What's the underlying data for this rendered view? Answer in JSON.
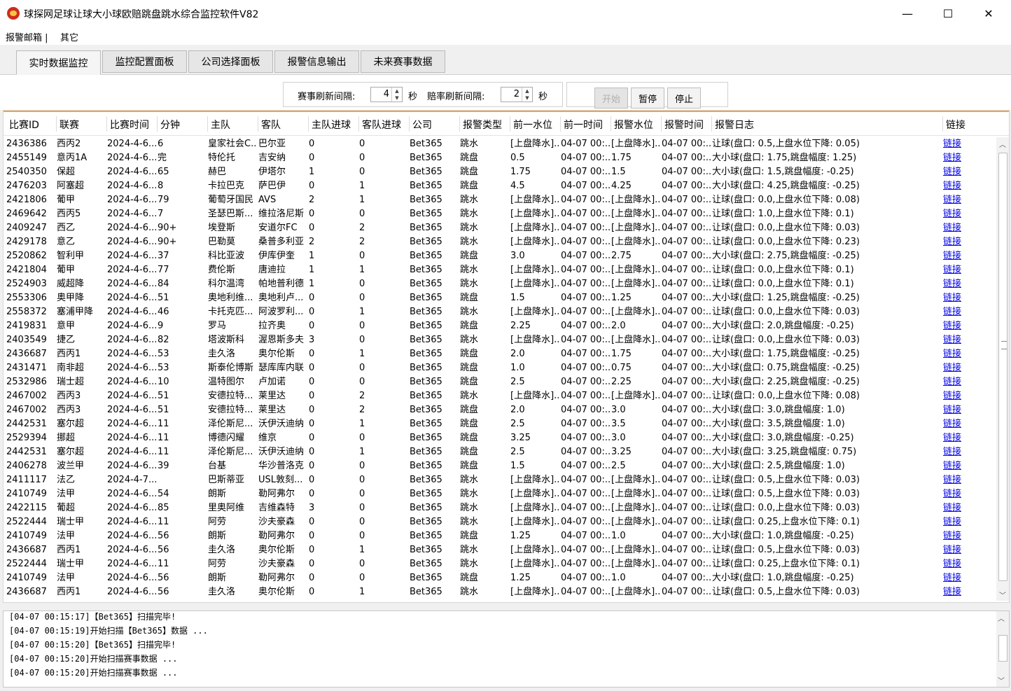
{
  "window": {
    "title": "球探网足球让球大小球欧赔跳盘跳水综合监控软件V82",
    "minimize": "—",
    "maximize": "☐",
    "close": "✕"
  },
  "menu": [
    "报警邮箱 |",
    "其它"
  ],
  "tabs": [
    "实时数据监控",
    "监控配置面板",
    "公司选择面板",
    "报警信息输出",
    "未来赛事数据"
  ],
  "controls": {
    "match_refresh_label": "赛事刷新间隔:",
    "match_refresh_value": "4",
    "odds_refresh_label": "赔率刷新间隔:",
    "odds_refresh_value": "2",
    "unit": "秒",
    "start": "开始",
    "pause": "暂停",
    "stop": "停止"
  },
  "grid": {
    "columns": [
      "比赛ID",
      "联赛",
      "比赛时间",
      "分钟",
      "主队",
      "客队",
      "主队进球",
      "客队进球",
      "公司",
      "报警类型",
      "前一水位",
      "前一时间",
      "报警水位",
      "报警时间",
      "报警日志",
      "链接"
    ],
    "rows": [
      [
        "2436386",
        "西丙2",
        "2024-4-6...",
        "6",
        "皇家社会C...",
        "巴尔亚",
        "0",
        "0",
        "Bet365",
        "跳水",
        "[上盘降水]...",
        "04-07 00:...",
        "[上盘降水]...",
        "04-07 00:...",
        "让球(盘口: 0.5,上盘水位下降: 0.05)",
        "链接"
      ],
      [
        "2455149",
        "意丙1A",
        "2024-4-6...",
        "完",
        "特伦托",
        "吉安纳",
        "0",
        "0",
        "Bet365",
        "跳盘",
        "0.5",
        "04-07 00:...",
        "1.75",
        "04-07 00:...",
        "大小球(盘口: 1.75,跳盘幅度: 1.25)",
        "链接"
      ],
      [
        "2540350",
        "保超",
        "2024-4-6...",
        "65",
        "赫巴",
        "伊塔尔",
        "1",
        "0",
        "Bet365",
        "跳盘",
        "1.75",
        "04-07 00:...",
        "1.5",
        "04-07 00:...",
        "大小球(盘口: 1.5,跳盘幅度: -0.25)",
        "链接"
      ],
      [
        "2476203",
        "阿塞超",
        "2024-4-6...",
        "8",
        "卡拉巴克",
        "萨巴伊",
        "0",
        "1",
        "Bet365",
        "跳盘",
        "4.5",
        "04-07 00:...",
        "4.25",
        "04-07 00:...",
        "大小球(盘口: 4.25,跳盘幅度: -0.25)",
        "链接"
      ],
      [
        "2421806",
        "葡甲",
        "2024-4-6...",
        "79",
        "葡萄牙国民",
        "AVS",
        "2",
        "1",
        "Bet365",
        "跳水",
        "[上盘降水]...",
        "04-07 00:...",
        "[上盘降水]...",
        "04-07 00:...",
        "让球(盘口: 0.0,上盘水位下降: 0.08)",
        "链接"
      ],
      [
        "2469642",
        "西丙5",
        "2024-4-6...",
        "7",
        "圣瑟巴斯...",
        "维拉洛尼斯",
        "0",
        "0",
        "Bet365",
        "跳水",
        "[上盘降水]...",
        "04-07 00:...",
        "[上盘降水]...",
        "04-07 00:...",
        "让球(盘口: 1.0,上盘水位下降: 0.1)",
        "链接"
      ],
      [
        "2409247",
        "西乙",
        "2024-4-6...",
        "90+",
        "埃登斯",
        "安道尔FC",
        "0",
        "2",
        "Bet365",
        "跳水",
        "[上盘降水]...",
        "04-07 00:...",
        "[上盘降水]...",
        "04-07 00:...",
        "让球(盘口: 0.0,上盘水位下降: 0.03)",
        "链接"
      ],
      [
        "2429178",
        "意乙",
        "2024-4-6...",
        "90+",
        "巴勒莫",
        "桑普多利亚",
        "2",
        "2",
        "Bet365",
        "跳水",
        "[上盘降水]...",
        "04-07 00:...",
        "[上盘降水]...",
        "04-07 00:...",
        "让球(盘口: 0.0,上盘水位下降: 0.23)",
        "链接"
      ],
      [
        "2520862",
        "智利甲",
        "2024-4-6...",
        "37",
        "科比亚波",
        "伊库伊奎",
        "1",
        "0",
        "Bet365",
        "跳盘",
        "3.0",
        "04-07 00:...",
        "2.75",
        "04-07 00:...",
        "大小球(盘口: 2.75,跳盘幅度: -0.25)",
        "链接"
      ],
      [
        "2421804",
        "葡甲",
        "2024-4-6...",
        "77",
        "费伦斯",
        "唐迪拉",
        "1",
        "1",
        "Bet365",
        "跳水",
        "[上盘降水]...",
        "04-07 00:...",
        "[上盘降水]...",
        "04-07 00:...",
        "让球(盘口: 0.0,上盘水位下降: 0.1)",
        "链接"
      ],
      [
        "2524903",
        "威超降",
        "2024-4-6...",
        "84",
        "科尔温湾",
        "帕地普利德",
        "1",
        "0",
        "Bet365",
        "跳水",
        "[上盘降水]...",
        "04-07 00:...",
        "[上盘降水]...",
        "04-07 00:...",
        "让球(盘口: 0.0,上盘水位下降: 0.1)",
        "链接"
      ],
      [
        "2553306",
        "奥甲降",
        "2024-4-6...",
        "51",
        "奥地利维...",
        "奥地利卢...",
        "0",
        "0",
        "Bet365",
        "跳盘",
        "1.5",
        "04-07 00:...",
        "1.25",
        "04-07 00:...",
        "大小球(盘口: 1.25,跳盘幅度: -0.25)",
        "链接"
      ],
      [
        "2558372",
        "塞浦甲降",
        "2024-4-6...",
        "46",
        "卡托克匹...",
        "阿波罗利...",
        "0",
        "1",
        "Bet365",
        "跳水",
        "[上盘降水]...",
        "04-07 00:...",
        "[上盘降水]...",
        "04-07 00:...",
        "让球(盘口: 0.0,上盘水位下降: 0.03)",
        "链接"
      ],
      [
        "2419831",
        "意甲",
        "2024-4-6...",
        "9",
        "罗马",
        "拉齐奥",
        "0",
        "0",
        "Bet365",
        "跳盘",
        "2.25",
        "04-07 00:...",
        "2.0",
        "04-07 00:...",
        "大小球(盘口: 2.0,跳盘幅度: -0.25)",
        "链接"
      ],
      [
        "2403549",
        "捷乙",
        "2024-4-6...",
        "82",
        "塔波斯科",
        "渥恩斯多夫",
        "3",
        "0",
        "Bet365",
        "跳水",
        "[上盘降水]...",
        "04-07 00:...",
        "[上盘降水]...",
        "04-07 00:...",
        "让球(盘口: 0.0,上盘水位下降: 0.03)",
        "链接"
      ],
      [
        "2436687",
        "西丙1",
        "2024-4-6...",
        "53",
        "圭久洛",
        "奥尔伦斯",
        "0",
        "1",
        "Bet365",
        "跳盘",
        "2.0",
        "04-07 00:...",
        "1.75",
        "04-07 00:...",
        "大小球(盘口: 1.75,跳盘幅度: -0.25)",
        "链接"
      ],
      [
        "2431471",
        "南非超",
        "2024-4-6...",
        "53",
        "斯泰伦博斯",
        "瑟库库内联",
        "0",
        "0",
        "Bet365",
        "跳盘",
        "1.0",
        "04-07 00:...",
        "0.75",
        "04-07 00:...",
        "大小球(盘口: 0.75,跳盘幅度: -0.25)",
        "链接"
      ],
      [
        "2532986",
        "瑞士超",
        "2024-4-6...",
        "10",
        "温特图尔",
        "卢加诺",
        "0",
        "0",
        "Bet365",
        "跳盘",
        "2.5",
        "04-07 00:...",
        "2.25",
        "04-07 00:...",
        "大小球(盘口: 2.25,跳盘幅度: -0.25)",
        "链接"
      ],
      [
        "2467002",
        "西丙3",
        "2024-4-6...",
        "51",
        "安德拉特...",
        "莱里达",
        "0",
        "2",
        "Bet365",
        "跳水",
        "[上盘降水]...",
        "04-07 00:...",
        "[上盘降水]...",
        "04-07 00:...",
        "让球(盘口: 0.0,上盘水位下降: 0.08)",
        "链接"
      ],
      [
        "2467002",
        "西丙3",
        "2024-4-6...",
        "51",
        "安德拉特...",
        "莱里达",
        "0",
        "2",
        "Bet365",
        "跳盘",
        "2.0",
        "04-07 00:...",
        "3.0",
        "04-07 00:...",
        "大小球(盘口: 3.0,跳盘幅度: 1.0)",
        "链接"
      ],
      [
        "2442531",
        "塞尔超",
        "2024-4-6...",
        "11",
        "泽伦斯尼...",
        "沃伊沃迪纳",
        "0",
        "1",
        "Bet365",
        "跳盘",
        "2.5",
        "04-07 00:...",
        "3.5",
        "04-07 00:...",
        "大小球(盘口: 3.5,跳盘幅度: 1.0)",
        "链接"
      ],
      [
        "2529394",
        "挪超",
        "2024-4-6...",
        "11",
        "博德闪耀",
        "维京",
        "0",
        "0",
        "Bet365",
        "跳盘",
        "3.25",
        "04-07 00:...",
        "3.0",
        "04-07 00:...",
        "大小球(盘口: 3.0,跳盘幅度: -0.25)",
        "链接"
      ],
      [
        "2442531",
        "塞尔超",
        "2024-4-6...",
        "11",
        "泽伦斯尼...",
        "沃伊沃迪纳",
        "0",
        "1",
        "Bet365",
        "跳盘",
        "2.5",
        "04-07 00:...",
        "3.25",
        "04-07 00:...",
        "大小球(盘口: 3.25,跳盘幅度: 0.75)",
        "链接"
      ],
      [
        "2406278",
        "波兰甲",
        "2024-4-6...",
        "39",
        "台基",
        "华沙普洛克",
        "0",
        "0",
        "Bet365",
        "跳盘",
        "1.5",
        "04-07 00:...",
        "2.5",
        "04-07 00:...",
        "大小球(盘口: 2.5,跳盘幅度: 1.0)",
        "链接"
      ],
      [
        "2411117",
        "法乙",
        "2024-4-7...",
        "",
        "巴斯蒂亚",
        "USL敦刻...",
        "0",
        "0",
        "Bet365",
        "跳水",
        "[上盘降水]...",
        "04-07 00:...",
        "[上盘降水]...",
        "04-07 00:...",
        "让球(盘口: 0.5,上盘水位下降: 0.03)",
        "链接"
      ],
      [
        "2410749",
        "法甲",
        "2024-4-6...",
        "54",
        "朗斯",
        "勒阿弗尔",
        "0",
        "0",
        "Bet365",
        "跳水",
        "[上盘降水]...",
        "04-07 00:...",
        "[上盘降水]...",
        "04-07 00:...",
        "让球(盘口: 0.5,上盘水位下降: 0.03)",
        "链接"
      ],
      [
        "2422115",
        "葡超",
        "2024-4-6...",
        "85",
        "里奥阿维",
        "吉维森特",
        "3",
        "0",
        "Bet365",
        "跳水",
        "[上盘降水]...",
        "04-07 00:...",
        "[上盘降水]...",
        "04-07 00:...",
        "让球(盘口: 0.0,上盘水位下降: 0.03)",
        "链接"
      ],
      [
        "2522444",
        "瑞士甲",
        "2024-4-6...",
        "11",
        "阿劳",
        "沙夫豪森",
        "0",
        "0",
        "Bet365",
        "跳水",
        "[上盘降水]...",
        "04-07 00:...",
        "[上盘降水]...",
        "04-07 00:...",
        "让球(盘口: 0.25,上盘水位下降: 0.1)",
        "链接"
      ],
      [
        "2410749",
        "法甲",
        "2024-4-6...",
        "56",
        "朗斯",
        "勒阿弗尔",
        "0",
        "0",
        "Bet365",
        "跳盘",
        "1.25",
        "04-07 00:...",
        "1.0",
        "04-07 00:...",
        "大小球(盘口: 1.0,跳盘幅度: -0.25)",
        "链接"
      ],
      [
        "2436687",
        "西丙1",
        "2024-4-6...",
        "56",
        "圭久洛",
        "奥尔伦斯",
        "0",
        "1",
        "Bet365",
        "跳水",
        "[上盘降水]...",
        "04-07 00:...",
        "[上盘降水]...",
        "04-07 00:...",
        "让球(盘口: 0.5,上盘水位下降: 0.03)",
        "链接"
      ],
      [
        "2522444",
        "瑞士甲",
        "2024-4-6...",
        "11",
        "阿劳",
        "沙夫豪森",
        "0",
        "0",
        "Bet365",
        "跳水",
        "[上盘降水]...",
        "04-07 00:...",
        "[上盘降水]...",
        "04-07 00:...",
        "让球(盘口: 0.25,上盘水位下降: 0.1)",
        "链接"
      ],
      [
        "2410749",
        "法甲",
        "2024-4-6...",
        "56",
        "朗斯",
        "勒阿弗尔",
        "0",
        "0",
        "Bet365",
        "跳盘",
        "1.25",
        "04-07 00:...",
        "1.0",
        "04-07 00:...",
        "大小球(盘口: 1.0,跳盘幅度: -0.25)",
        "链接"
      ],
      [
        "2436687",
        "西丙1",
        "2024-4-6...",
        "56",
        "圭久洛",
        "奥尔伦斯",
        "0",
        "1",
        "Bet365",
        "跳水",
        "[上盘降水]...",
        "04-07 00:...",
        "[上盘降水]...",
        "04-07 00:...",
        "让球(盘口: 0.5,上盘水位下降: 0.03)",
        "链接"
      ]
    ]
  },
  "log": [
    "[04-07 00:15:17]【Bet365】扫描完毕!",
    "[04-07 00:15:19]开始扫描【Bet365】数据 ...",
    "[04-07 00:15:20]【Bet365】扫描完毕!",
    "[04-07 00:15:20]开始扫描赛事数据 ...",
    "[04-07 00:15:20]开始扫描赛事数据 ..."
  ],
  "colors": {
    "accent": "#f0a34a",
    "link": "#0000ee"
  }
}
